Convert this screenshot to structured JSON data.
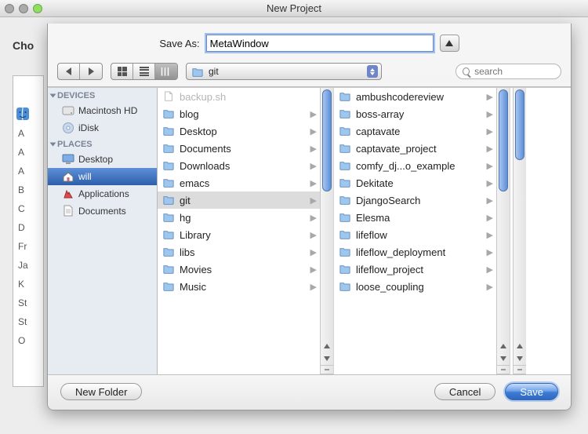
{
  "parent_window": {
    "title": "New Project",
    "prompt": "Cho",
    "obscured_list": [
      "A",
      "A",
      "A",
      "B",
      "C",
      "D",
      "Fr",
      "Ja",
      "K",
      "St",
      "St",
      "O"
    ]
  },
  "sheet": {
    "save_as_label": "Save As:",
    "filename": "MetaWindow",
    "path_popup": "git",
    "search_placeholder": "search",
    "sidebar": {
      "section_devices": "DEVICES",
      "section_places": "PLACES",
      "devices": [
        {
          "label": "Macintosh HD",
          "icon": "hdd"
        },
        {
          "label": "iDisk",
          "icon": "idisk"
        }
      ],
      "places": [
        {
          "label": "Desktop",
          "icon": "desktop"
        },
        {
          "label": "will",
          "icon": "home",
          "selected": true
        },
        {
          "label": "Applications",
          "icon": "apps"
        },
        {
          "label": "Documents",
          "icon": "doc"
        }
      ]
    },
    "columns": [
      {
        "items": [
          {
            "label": "backup.sh",
            "type": "file",
            "dim": true
          },
          {
            "label": "blog",
            "type": "folder"
          },
          {
            "label": "Desktop",
            "type": "folder"
          },
          {
            "label": "Documents",
            "type": "folder"
          },
          {
            "label": "Downloads",
            "type": "folder"
          },
          {
            "label": "emacs",
            "type": "folder"
          },
          {
            "label": "git",
            "type": "folder",
            "selected": true
          },
          {
            "label": "hg",
            "type": "folder"
          },
          {
            "label": "Library",
            "type": "folder"
          },
          {
            "label": "libs",
            "type": "folder"
          },
          {
            "label": "Movies",
            "type": "folder"
          },
          {
            "label": "Music",
            "type": "folder"
          }
        ]
      },
      {
        "items": [
          {
            "label": "ambushcodereview",
            "type": "folder"
          },
          {
            "label": "boss-array",
            "type": "folder"
          },
          {
            "label": "captavate",
            "type": "folder"
          },
          {
            "label": "captavate_project",
            "type": "folder"
          },
          {
            "label": "comfy_dj...o_example",
            "type": "folder"
          },
          {
            "label": "Dekitate",
            "type": "folder"
          },
          {
            "label": "DjangoSearch",
            "type": "folder"
          },
          {
            "label": "Elesma",
            "type": "folder"
          },
          {
            "label": "lifeflow",
            "type": "folder"
          },
          {
            "label": "lifeflow_deployment",
            "type": "folder"
          },
          {
            "label": "lifeflow_project",
            "type": "folder"
          },
          {
            "label": "loose_coupling",
            "type": "folder"
          }
        ]
      }
    ],
    "buttons": {
      "new_folder": "New Folder",
      "cancel": "Cancel",
      "save": "Save"
    }
  }
}
